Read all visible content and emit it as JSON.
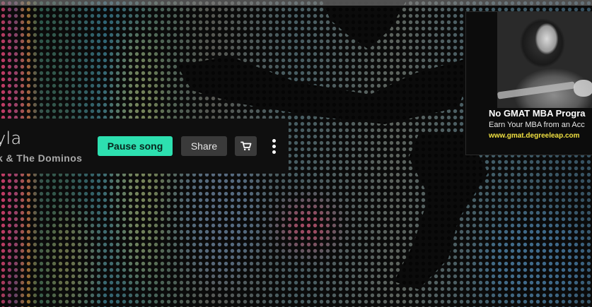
{
  "player": {
    "song_title": "yla",
    "artist": "k & The Dominos",
    "pause_label": "Pause song",
    "share_label": "Share",
    "cart_icon": "cart-icon",
    "more_icon": "more-vertical-icon"
  },
  "ad": {
    "title": "No GMAT MBA Progra",
    "subtitle": "Earn Your MBA from an Acc",
    "url": "www.gmat.degreeleap.com"
  },
  "colors": {
    "accent": "#2de0b0",
    "button_dark": "#3a3a3a",
    "ad_url": "#f0e040"
  }
}
